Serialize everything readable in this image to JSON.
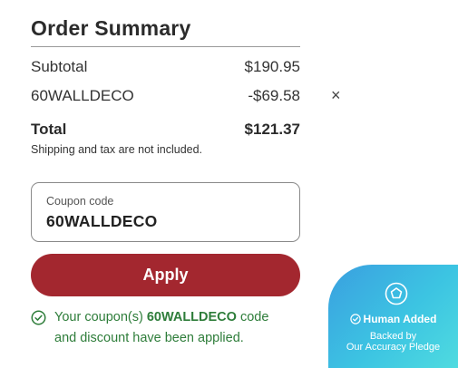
{
  "summary": {
    "title": "Order Summary",
    "subtotal_label": "Subtotal",
    "subtotal_value": "$190.95",
    "discount_label": "60WALLDECO",
    "discount_value": "-$69.58",
    "remove_symbol": "×",
    "total_label": "Total",
    "total_value": "$121.37",
    "shipping_note": "Shipping and tax are not included."
  },
  "coupon": {
    "label": "Coupon code",
    "value": "60WALLDECO",
    "apply_label": "Apply"
  },
  "success": {
    "prefix": "Your coupon(s) ",
    "code": "60WALLDECO",
    "suffix": " code",
    "line2": "and discount have been applied."
  },
  "badge": {
    "title": "Human Added",
    "line1": "Backed by",
    "line2": "Our Accuracy Pledge"
  },
  "colors": {
    "accent": "#a3272f",
    "success": "#2e7d3a",
    "badge_start": "#3a9fe0",
    "badge_end": "#4fdbe0"
  },
  "icons": {
    "remove": "close-icon",
    "success": "check-circle-icon",
    "badge_shape": "pentagon-icon",
    "badge_check": "check-circle-icon"
  }
}
